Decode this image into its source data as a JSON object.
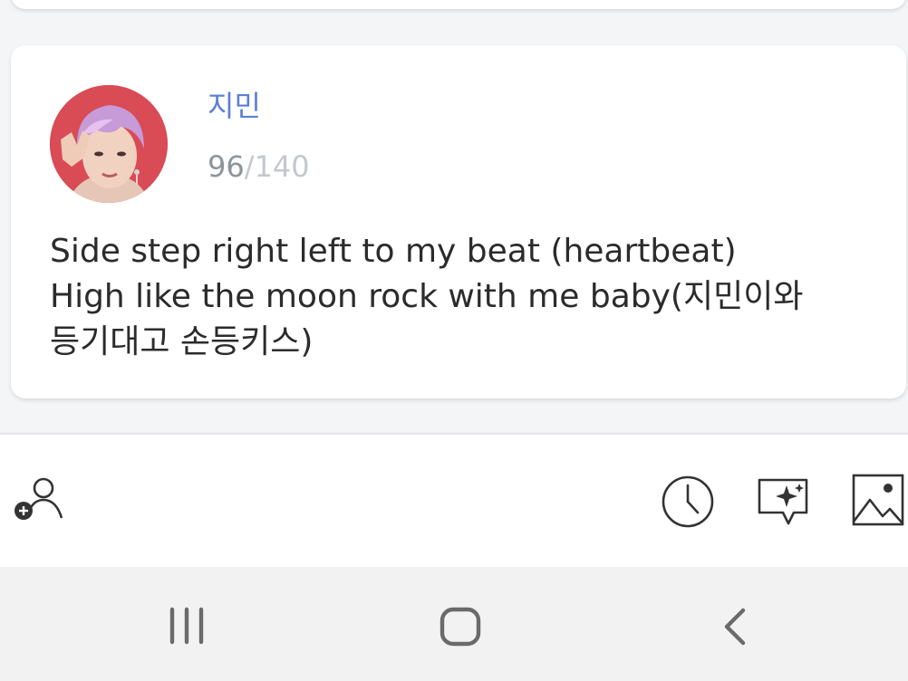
{
  "post": {
    "author_name": "지민",
    "char_count": "96",
    "char_limit": "/140",
    "message_lines": [
      "Side step right left to my beat (heartbeat)",
      "High like the moon rock with me baby(지민이와",
      "등기대고 손등키스)"
    ]
  },
  "toolbar": {
    "left_icon": "add-person-icon",
    "right_icons": [
      "clock-icon",
      "ai-sparkle-chat-icon",
      "image-icon"
    ]
  },
  "navbar": {
    "icons": [
      "recent-apps-icon",
      "home-icon",
      "back-icon"
    ]
  },
  "colors": {
    "author_name": "#5b7fd6",
    "char_count": "#8d949c",
    "char_limit": "#c3c8ce",
    "avatar_background": "#d94b55"
  }
}
